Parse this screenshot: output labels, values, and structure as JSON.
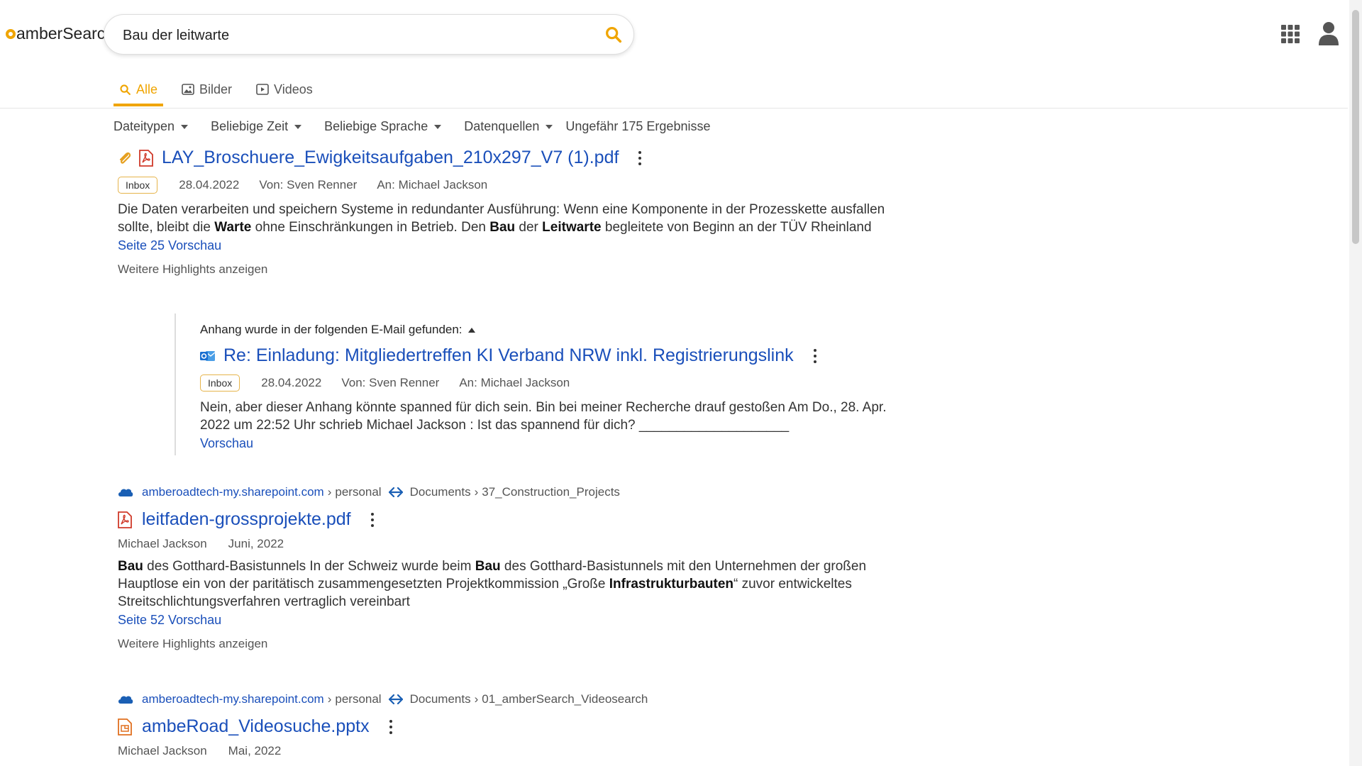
{
  "brand": {
    "logo_text": "amberSearch",
    "accent": "#f0a500"
  },
  "search": {
    "query": "Bau der leitwarte",
    "button_icon": "search-icon"
  },
  "header": {
    "apps_icon": "apps-grid-icon",
    "user_icon": "user-icon"
  },
  "tabs": [
    {
      "label": "Alle",
      "icon": "search-icon",
      "active": true
    },
    {
      "label": "Bilder",
      "icon": "image-icon",
      "active": false
    },
    {
      "label": "Videos",
      "icon": "video-icon",
      "active": false
    }
  ],
  "filters": {
    "items": [
      "Dateitypen",
      "Beliebige Zeit",
      "Beliebige Sprache",
      "Datenquellen"
    ],
    "result_count": "Ungefähr 175 Ergebnisse"
  },
  "results": {
    "r1": {
      "title": "LAY_Broschuere_Ewigkeitsaufgaben_210x297_V7 (1).pdf",
      "badge": "Inbox",
      "date": "28.04.2022",
      "from": "Von: Sven Renner",
      "to": "An: Michael Jackson",
      "snippet_parts": [
        "Die Daten verarbeiten und speichern Systeme in redundanter Ausführung: Wenn eine Komponente in der Prozesskette ausfallen sollte, bleibt die ",
        "Warte",
        " ohne Einschränkungen in Betrieb. Den ",
        "Bau",
        " der ",
        "Leitwarte",
        " begleitete von Beginn an der TÜV Rheinland"
      ],
      "preview_link": "Seite 25 Vorschau",
      "more_highlights": "Weitere Highlights anzeigen"
    },
    "attachment": {
      "found_label": "Anhang wurde in der folgenden E-Mail gefunden:",
      "title": "Re: Einladung: Mitgliedertreffen KI Verband NRW inkl. Registrierungslink",
      "badge": "Inbox",
      "date": "28.04.2022",
      "from": "Von: Sven Renner",
      "to": "An: Michael Jackson",
      "snippet": "Nein, aber dieser Anhang könnte spanned für dich sein. Bin bei meiner Recherche drauf gestoßen Am Do., 28. Apr. 2022 um 22:52 Uhr schrieb Michael Jackson : Ist das spannend für dich? ____________________",
      "preview_link": "Vorschau"
    },
    "r2": {
      "crumb_domain": "amberoadtech-my.sharepoint.com",
      "crumb_sep1": "›",
      "crumb_personal": "personal",
      "crumb_docs": "Documents",
      "crumb_sep2": "›",
      "crumb_folder": "37_Construction_Projects",
      "title": "leitfaden-grossprojekte.pdf",
      "author": "Michael Jackson",
      "date": "Juni, 2022",
      "snippet_parts": [
        "Bau",
        " des Gotthard-Basistunnels In der Schweiz wurde beim ",
        "Bau",
        " des Gotthard-Basistunnels mit den Unternehmen der großen Hauptlose ein von der paritätisch zusammengesetzten Projektkommission „Große ",
        "Infrastrukturbauten",
        "“ zuvor entwickeltes Streitschlichtungsverfahren vertraglich vereinbart"
      ],
      "preview_link": "Seite 52 Vorschau",
      "more_highlights": "Weitere Highlights anzeigen"
    },
    "r3": {
      "crumb_domain": "amberoadtech-my.sharepoint.com",
      "crumb_sep1": "›",
      "crumb_personal": "personal",
      "crumb_docs": "Documents",
      "crumb_sep2": "›",
      "crumb_folder": "01_amberSearch_Videosearch",
      "title": "ambeRoad_Videosuche.pptx",
      "author": "Michael Jackson",
      "date": "Mai, 2022"
    }
  }
}
